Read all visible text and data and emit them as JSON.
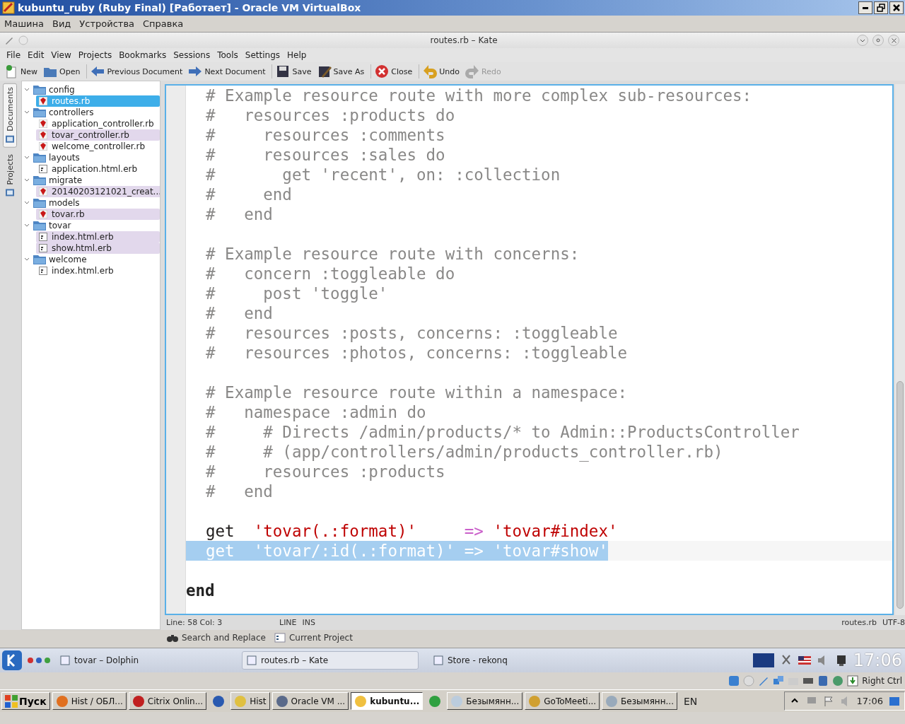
{
  "vbox_window": {
    "title": "kubuntu_ruby (Ruby Final) [Работает] - Oracle VM VirtualBox",
    "menu": [
      "Машина",
      "Вид",
      "Устройства",
      "Справка"
    ]
  },
  "kate": {
    "title": "routes.rb – Kate",
    "menu": [
      "File",
      "Edit",
      "View",
      "Projects",
      "Bookmarks",
      "Sessions",
      "Tools",
      "Settings",
      "Help"
    ],
    "toolbar": [
      {
        "label": "New",
        "kind": "new",
        "disabled": false
      },
      {
        "label": "Open",
        "kind": "open",
        "disabled": false
      },
      {
        "label": "Previous Document",
        "kind": "prev",
        "disabled": false
      },
      {
        "label": "Next Document",
        "kind": "next",
        "disabled": false
      },
      {
        "label": "Save",
        "kind": "save",
        "disabled": false
      },
      {
        "label": "Save As",
        "kind": "saveas",
        "disabled": false
      },
      {
        "label": "Close",
        "kind": "close",
        "disabled": false
      },
      {
        "label": "Undo",
        "kind": "undo",
        "disabled": false
      },
      {
        "label": "Redo",
        "kind": "redo",
        "disabled": true
      }
    ],
    "side_tabs": [
      {
        "label": "Documents",
        "selected": true
      },
      {
        "label": "Projects",
        "selected": false
      }
    ],
    "tree": [
      {
        "label": "config",
        "children": [
          {
            "label": "routes.rb",
            "kind": "ruby",
            "selected": true,
            "highlighted": false
          }
        ]
      },
      {
        "label": "controllers",
        "children": [
          {
            "label": "application_controller.rb",
            "kind": "ruby",
            "selected": false,
            "highlighted": false
          },
          {
            "label": "tovar_controller.rb",
            "kind": "ruby",
            "selected": false,
            "highlighted": true
          },
          {
            "label": "welcome_controller.rb",
            "kind": "ruby",
            "selected": false,
            "highlighted": false
          }
        ]
      },
      {
        "label": "layouts",
        "children": [
          {
            "label": "application.html.erb",
            "kind": "template",
            "selected": false,
            "highlighted": false
          }
        ]
      },
      {
        "label": "migrate",
        "children": [
          {
            "label": "20140203121021_creat...",
            "kind": "ruby",
            "selected": false,
            "highlighted": true
          }
        ]
      },
      {
        "label": "models",
        "children": [
          {
            "label": "tovar.rb",
            "kind": "ruby",
            "selected": false,
            "highlighted": true
          }
        ]
      },
      {
        "label": "tovar",
        "children": [
          {
            "label": "index.html.erb",
            "kind": "template",
            "selected": false,
            "highlighted": true
          },
          {
            "label": "show.html.erb",
            "kind": "template",
            "selected": false,
            "highlighted": true
          }
        ]
      },
      {
        "label": "welcome",
        "children": [
          {
            "label": "index.html.erb",
            "kind": "template",
            "selected": false,
            "highlighted": false
          }
        ]
      }
    ],
    "code": [
      {
        "kind": "comment",
        "text": "# Example resource route with more complex sub-resources:"
      },
      {
        "kind": "comment",
        "text": "#   resources :products do"
      },
      {
        "kind": "comment",
        "text": "#     resources :comments"
      },
      {
        "kind": "comment",
        "text": "#     resources :sales do"
      },
      {
        "kind": "comment",
        "text": "#       get 'recent', on: :collection"
      },
      {
        "kind": "comment",
        "text": "#     end"
      },
      {
        "kind": "comment",
        "text": "#   end"
      },
      {
        "kind": "blank"
      },
      {
        "kind": "comment",
        "text": "# Example resource route with concerns:"
      },
      {
        "kind": "comment",
        "text": "#   concern :toggleable do"
      },
      {
        "kind": "comment",
        "text": "#     post 'toggle'"
      },
      {
        "kind": "comment",
        "text": "#   end"
      },
      {
        "kind": "comment",
        "text": "#   resources :posts, concerns: :toggleable"
      },
      {
        "kind": "comment",
        "text": "#   resources :photos, concerns: :toggleable"
      },
      {
        "kind": "blank"
      },
      {
        "kind": "comment",
        "text": "# Example resource route within a namespace:"
      },
      {
        "kind": "comment",
        "text": "#   namespace :admin do"
      },
      {
        "kind": "comment",
        "text": "#     # Directs /admin/products/* to Admin::ProductsController"
      },
      {
        "kind": "comment",
        "text": "#     # (app/controllers/admin/products_controller.rb)"
      },
      {
        "kind": "comment",
        "text": "#     resources :products"
      },
      {
        "kind": "comment",
        "text": "#   end"
      },
      {
        "kind": "blank"
      },
      {
        "kind": "code",
        "selected": false,
        "tokens": [
          {
            "kind": "plain",
            "text": "get"
          },
          {
            "kind": "string",
            "text": "  'tovar(.:format)'"
          },
          {
            "kind": "op",
            "text": "     =>"
          },
          {
            "kind": "string",
            "text": " 'tovar#index'"
          }
        ]
      },
      {
        "kind": "code",
        "selected": true,
        "tokens": [
          {
            "kind": "plain",
            "text": "get"
          },
          {
            "kind": "string",
            "text": "  'tovar/:id(.:format)'"
          },
          {
            "kind": "op",
            "text": " =>"
          },
          {
            "kind": "string",
            "text": " 'tovar#show'"
          }
        ]
      },
      {
        "kind": "blank"
      },
      {
        "kind": "keyword",
        "text": "end"
      }
    ],
    "status": {
      "position": "Line: 58 Col: 3",
      "mode": "LINE",
      "insert": "INS",
      "file": "routes.rb",
      "encoding": "UTF-8"
    },
    "bottom_tools": [
      {
        "label": "Search and Replace",
        "kind": "search"
      },
      {
        "label": "Current Project",
        "kind": "project"
      }
    ]
  },
  "kde_panel": {
    "tasks": [
      {
        "label": "tovar – Dolphin",
        "selected": false
      },
      {
        "label": "routes.rb – Kate",
        "selected": true
      },
      {
        "label": "Store - rekonq",
        "selected": false
      }
    ],
    "clock": "17:06"
  },
  "vbox_status": {
    "host_key": "Right Ctrl"
  },
  "windows_taskbar": {
    "start": "Пуск",
    "items": [
      {
        "label": "Hist / ОБЛ...",
        "selected": false
      },
      {
        "label": "Citrix Onlin...",
        "selected": false
      },
      {
        "selected": false
      },
      {
        "label": "Hist",
        "selected": false
      },
      {
        "label": "Oracle VM ...",
        "selected": false
      },
      {
        "label": "kubuntu...",
        "selected": true
      },
      {
        "selected": false
      },
      {
        "label": "Безымянн...",
        "selected": false
      },
      {
        "label": "GoToMeeti...",
        "selected": false
      },
      {
        "label": "Безымянн...",
        "selected": false
      }
    ],
    "language": "EN",
    "clock": "17:06"
  }
}
